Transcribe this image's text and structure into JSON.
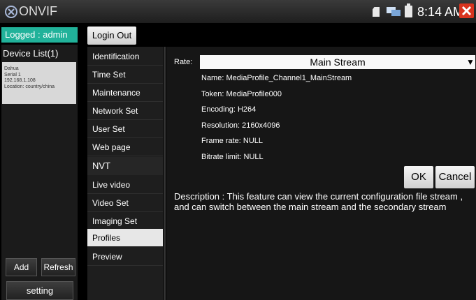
{
  "titlebar": {
    "app_title": "ONVIF",
    "time": "8:14 AM"
  },
  "sidebar": {
    "logged_in": "Logged : admin",
    "device_list_title": "Device List(1)",
    "device": {
      "brand": "Dahua",
      "serial": "Serial 1",
      "ip": "192.168.1.108",
      "location": "Location: country/china"
    },
    "add_label": "Add",
    "refresh_label": "Refresh",
    "setting_label": "setting"
  },
  "menu": {
    "login_out_label": "Login Out",
    "items": [
      {
        "label": "Identification"
      },
      {
        "label": "Time Set"
      },
      {
        "label": "Maintenance"
      },
      {
        "label": "Network Set"
      },
      {
        "label": "User Set"
      },
      {
        "label": "Web page"
      }
    ],
    "section_label": "NVT",
    "nvt_items": [
      {
        "label": "Live video"
      },
      {
        "label": "Video Set"
      },
      {
        "label": "Imaging Set"
      },
      {
        "label": "Profiles"
      },
      {
        "label": "Preview"
      }
    ],
    "active_item": "Profiles"
  },
  "profile": {
    "rate_label": "Rate:",
    "rate_value": "Main Stream",
    "name": "Name:  MediaProfile_Channel1_MainStream",
    "token": "Token:  MediaProfile000",
    "encoding": "Encoding:  H264",
    "resolution": "Resolution:  2160x4096",
    "frame_rate": "Frame rate:  NULL",
    "bitrate_limit": "Bitrate limit:  NULL",
    "ok_label": "OK",
    "cancel_label": "Cancel",
    "description": "Description : This feature can view the current configuration file stream , and can switch between the main stream and the secondary stream"
  },
  "colors": {
    "accent": "#21b29a",
    "close": "#d9341f",
    "active_menu_bg": "#e7e7e7"
  },
  "icons": {
    "app": "onvif-x-icon",
    "sd": "sd-card-icon",
    "net": "network-icon",
    "battery": "battery-icon",
    "close": "close-icon",
    "dropdown": "dropdown-arrow-icon"
  }
}
